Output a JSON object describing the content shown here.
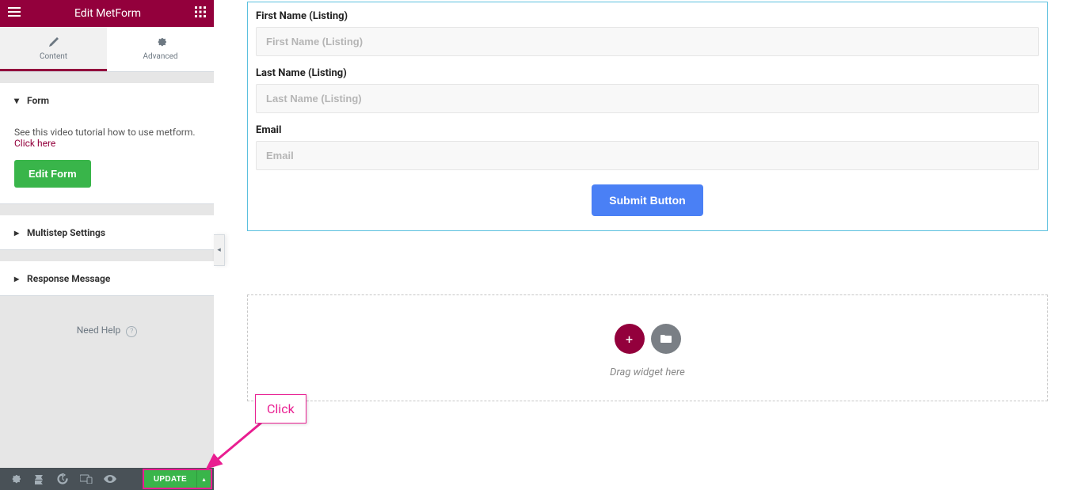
{
  "header": {
    "title": "Edit MetForm"
  },
  "tabs": {
    "content": "Content",
    "advanced": "Advanced"
  },
  "sections": {
    "form": {
      "label": "Form",
      "tutorial_text": "See this video tutorial how to use metform.",
      "tutorial_link": "Click here",
      "edit_button": "Edit Form"
    },
    "multistep": {
      "label": "Multistep Settings"
    },
    "response": {
      "label": "Response Message"
    }
  },
  "need_help": {
    "label": "Need Help"
  },
  "footer": {
    "update": "UPDATE"
  },
  "form": {
    "first_name_label": "First Name (Listing)",
    "first_name_placeholder": "First Name (Listing)",
    "last_name_label": "Last Name (Listing)",
    "last_name_placeholder": "Last Name (Listing)",
    "email_label": "Email",
    "email_placeholder": "Email",
    "submit": "Submit Button"
  },
  "dropzone": {
    "hint": "Drag widget here"
  },
  "annotation": {
    "label": "Click"
  }
}
